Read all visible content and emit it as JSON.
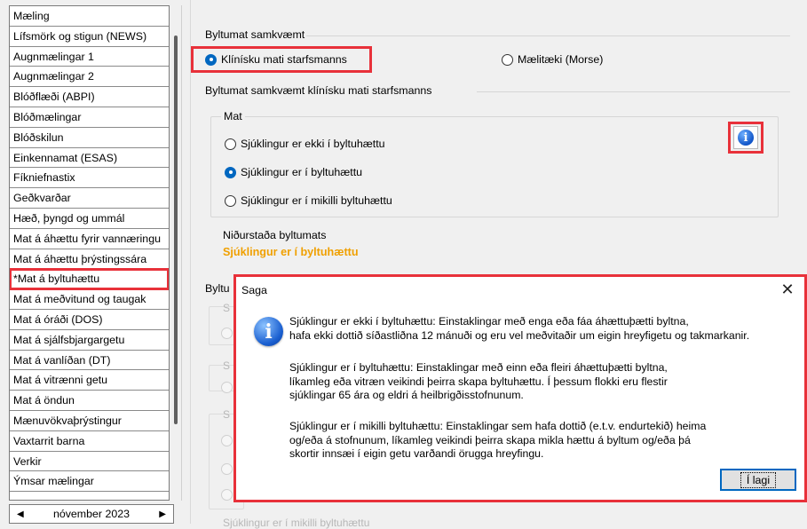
{
  "sidebar": {
    "items": [
      {
        "label": "Mæling"
      },
      {
        "label": "Lífsmörk og stigun (NEWS)"
      },
      {
        "label": "Augnmælingar 1"
      },
      {
        "label": "Augnmælingar 2"
      },
      {
        "label": "Blóðflæði (ABPI)"
      },
      {
        "label": "Blóðmælingar"
      },
      {
        "label": "Blóðskilun"
      },
      {
        "label": "Einkennamat (ESAS)"
      },
      {
        "label": "Fíkniefnastix"
      },
      {
        "label": "Geðkvarðar"
      },
      {
        "label": "Hæð, þyngd og ummál"
      },
      {
        "label": "Mat á áhættu fyrir vannæringu"
      },
      {
        "label": "Mat á áhættu þrýstingssára"
      },
      {
        "label": "*Mat á byltuhættu"
      },
      {
        "label": "Mat á meðvitund og taugak"
      },
      {
        "label": "Mat á óráði (DOS)"
      },
      {
        "label": "Mat á sjálfsbjargargetu"
      },
      {
        "label": "Mat á vanlíðan (DT)"
      },
      {
        "label": "Mat á vitrænni getu"
      },
      {
        "label": "Mat á öndun"
      },
      {
        "label": "Mænuvökvaþrýstingur"
      },
      {
        "label": "Vaxtarrit barna"
      },
      {
        "label": "Verkir"
      },
      {
        "label": "Ýmsar mælingar"
      }
    ],
    "selected_index": 13,
    "month_nav": {
      "prev": "◀",
      "label": "nóvember 2023",
      "next": "▶"
    }
  },
  "main": {
    "assessment_basis": {
      "title": "Byltumat samkvæmt",
      "option_clinical": "Klínísku mati starfsmanns",
      "option_device": "Mælitæki (Morse)"
    },
    "clinical_section": {
      "title": "Byltumat samkvæmt klínísku mati starfsmanns",
      "mat_title": "Mat",
      "options": [
        "Sjúklingur er ekki í byltuhættu",
        "Sjúklingur er í byltuhættu",
        "Sjúklingur er í mikilli byltuhættu"
      ],
      "selected_option": 1,
      "result_label": "Niðurstaða byltumats",
      "result_value": "Sjúklingur er í byltuhættu"
    },
    "partial_group_title": "Byltu",
    "ghost_prefix": "S",
    "bottom_ghost_text": "Sjúklingur er í mikilli byltuhættu"
  },
  "dialog": {
    "title": "Saga",
    "close_label": "✕",
    "messages": [
      "Sjúklingur er ekki í byltuhættu: Einstaklingar með enga eða fáa áhættuþætti byltna,\nhafa ekki dottið síðastliðna 12 mánuði og eru vel meðvitaðir um eigin hreyfigetu og takmarkanir.",
      "Sjúklingur er í byltuhættu: Einstaklingar með einn eða fleiri áhættuþætti byltna,\nlíkamleg eða vitræn veikindi þeirra skapa byltuhættu. Í þessum flokki eru flestir\nsjúklingar 65 ára og eldri á heilbrigðisstofnunum.",
      "Sjúklingur er í mikilli byltuhættu: Einstaklingar sem hafa dottið (e.t.v. endurtekið) heima\nog/eða á stofnunum, líkamleg veikindi þeirra skapa mikla hættu á byltum og/eða þá\nskortir innsæi í eigin getu varðandi örugga hreyfingu."
    ],
    "ok_label": "Í lagi"
  },
  "colors": {
    "highlight_red": "#e8313a",
    "result_orange": "#f0a000",
    "radio_blue": "#0067c0"
  }
}
